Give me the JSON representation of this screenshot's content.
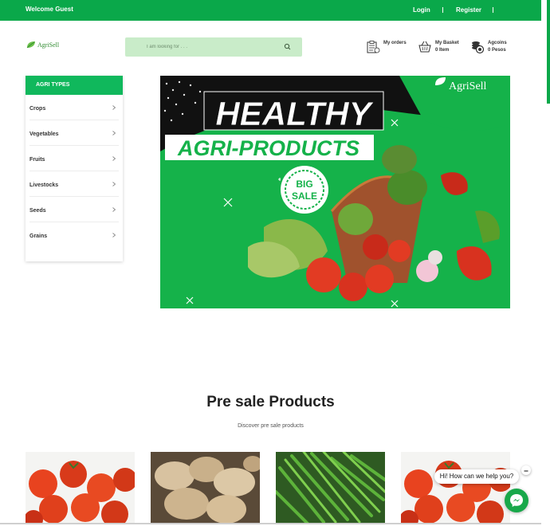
{
  "topbar": {
    "welcome": "Welcome Guest",
    "login": "Login",
    "register": "Register",
    "color": "#0aa84a"
  },
  "logo": {
    "text": "AgriSell"
  },
  "search": {
    "placeholder": "I am looking for . . ."
  },
  "header": {
    "orders": {
      "label": "My orders",
      "icon": "clipboard-icon"
    },
    "basket": {
      "label": "My Basket",
      "count": "0 Item",
      "icon": "basket-icon"
    },
    "coins": {
      "label": "Agcoins",
      "amount": "0 Pesos",
      "icon": "coins-icon"
    }
  },
  "sidebar": {
    "title": "AGRI TYPES",
    "items": [
      {
        "label": "Crops"
      },
      {
        "label": "Vegetables"
      },
      {
        "label": "Fruits"
      },
      {
        "label": "Livestocks"
      },
      {
        "label": "Seeds"
      },
      {
        "label": "Grains"
      }
    ]
  },
  "banner": {
    "line1": "HEALTHY",
    "line2": "AGRI-PRODUCTS",
    "badge_top": "BIG",
    "badge_bottom": "SALE",
    "brand": "AgriSell"
  },
  "presale": {
    "title": "Pre sale Products",
    "subtitle": "Discover pre sale products"
  },
  "products": [
    {
      "image": "tomatoes"
    },
    {
      "image": "ginger"
    },
    {
      "image": "green-beans"
    },
    {
      "image": "tomatoes"
    }
  ],
  "chat": {
    "greeting": "Hi! How can we help you?"
  }
}
